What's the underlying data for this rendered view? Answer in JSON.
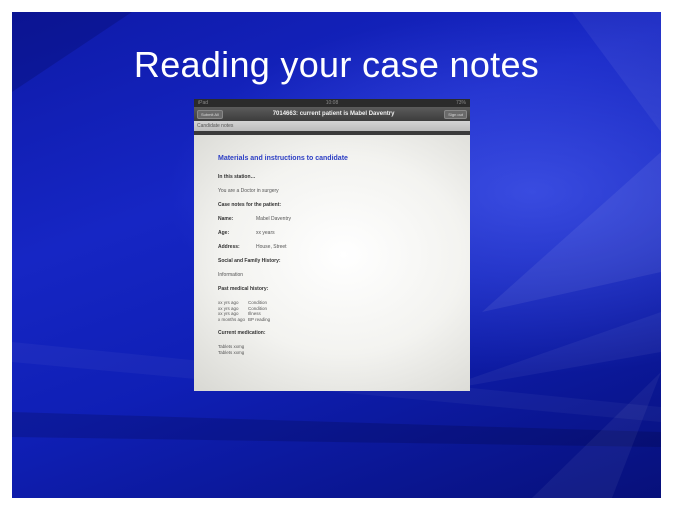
{
  "slide": {
    "title": "Reading your case notes"
  },
  "photo": {
    "statusbar": {
      "left": "iPad",
      "center": "10:08",
      "right": "73%"
    },
    "navbar": {
      "left_button": "Submit All",
      "title": "7014663: current patient is Mabel Daventry",
      "right_button": "Sign out"
    },
    "subbar": "Candidate notes",
    "document": {
      "heading": "Materials and instructions to candidate",
      "in_station_label": "In this station…",
      "in_station_text": "You are a Doctor in surgery",
      "case_notes_label": "Case notes for the patient:",
      "fields": [
        {
          "key": "Name:",
          "value": "Mabel Daventry"
        },
        {
          "key": "Age:",
          "value": "xx years"
        },
        {
          "key": "Address:",
          "value": "House, Street"
        }
      ],
      "social_label": "Social and Family History:",
      "social_text": "Information",
      "pmh_label": "Past medical history:",
      "history": [
        {
          "when": "xx yrs ago",
          "what": "Condition"
        },
        {
          "when": "xx yrs ago",
          "what": "Condition"
        },
        {
          "when": "xx yrs ago",
          "what": "Illness"
        },
        {
          "when": "x months ago",
          "what": "BP reading"
        }
      ],
      "meds_label": "Current medication:",
      "meds": [
        "Tablets xxmg",
        "Tablets xxmg"
      ]
    }
  }
}
